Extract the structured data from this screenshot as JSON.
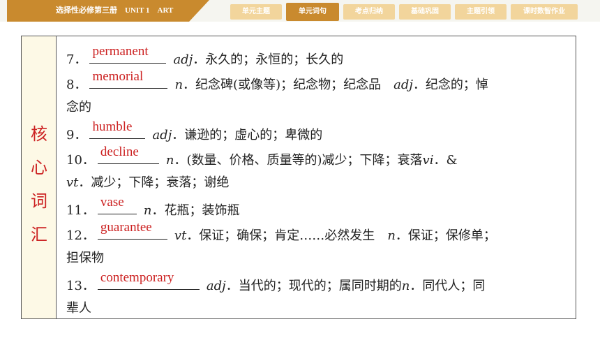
{
  "header": {
    "title": "选择性必修第三册　UNIT 1　ART"
  },
  "tabs": [
    {
      "label": "单元主题",
      "active": false
    },
    {
      "label": "单元词句",
      "active": true
    },
    {
      "label": "考点归纳",
      "active": false
    },
    {
      "label": "基础巩固",
      "active": false
    },
    {
      "label": "主题引领",
      "active": false
    },
    {
      "label": "课时数智作业",
      "active": false
    }
  ],
  "side": [
    "核",
    "心",
    "词",
    "汇"
  ],
  "entries": {
    "e7": {
      "num": "7．",
      "answer": "permanent",
      "pos": "adj",
      "text": "．永久的；永恒的；长久的"
    },
    "e8": {
      "num": "8．",
      "answer": "memorial",
      "pos": "n",
      "text": "．纪念碑(或像等)；纪念物；纪念品　",
      "pos2": "adj",
      "text2": "．纪念的；悼",
      "cont": "念的"
    },
    "e9": {
      "num": "9．",
      "answer": "humble",
      "pos": "adj",
      "text": "．谦逊的；虚心的；卑微的"
    },
    "e10": {
      "num": "10．",
      "answer": "decline",
      "pos": "n",
      "text": "．(数量、价格、质量等的)减少；下降；衰落",
      "pos2": "vi",
      "text2": "．&",
      "cont_pos": "vt",
      "cont": "．减少；下降；衰落；谢绝"
    },
    "e11": {
      "num": "11．",
      "answer": "vase",
      "pos": "n",
      "text": "．花瓶；装饰瓶"
    },
    "e12": {
      "num": "12．",
      "answer": "guarantee",
      "pos": "vt",
      "text": "．保证；确保；肯定……必然发生　",
      "pos2": "n",
      "text2": "．保证；保修单；",
      "cont": "担保物"
    },
    "e13": {
      "num": "13．",
      "answer": "contemporary",
      "pos": "adj",
      "text": "．当代的；现代的；属同时期的",
      "pos2": "n",
      "text2": "．同代人；同",
      "cont": "辈人"
    }
  }
}
